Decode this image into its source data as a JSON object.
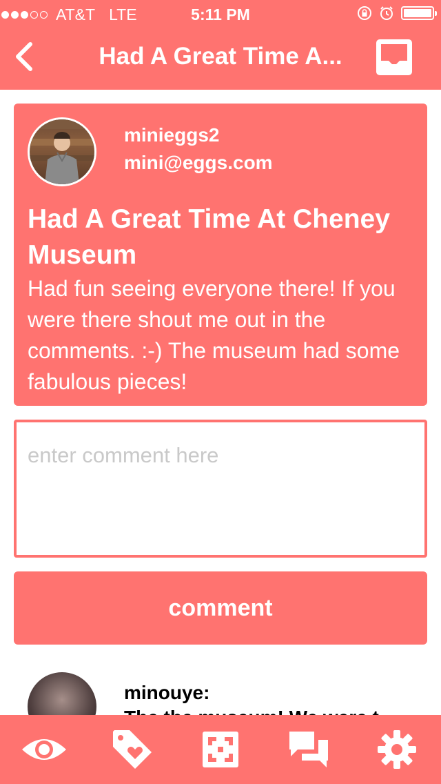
{
  "status_bar": {
    "carrier": "AT&T",
    "network": "LTE",
    "time": "5:11 PM",
    "signal_dots_filled": 3,
    "signal_dots_total": 5
  },
  "nav": {
    "title": "Had A Great Time A...",
    "back_icon": "chevron-left-icon",
    "inbox_icon": "inbox-icon"
  },
  "post": {
    "username": "minieggs2",
    "email": "mini@eggs.com",
    "title": "Had A Great Time At Cheney Museum",
    "body": "Had fun seeing everyone there! If you were there shout me out in the comments. :-) The museum had some fabulous pieces!"
  },
  "comment_input": {
    "placeholder": "enter comment here",
    "value": ""
  },
  "comment_button": {
    "label": "comment"
  },
  "comments": [
    {
      "user": "minouye:",
      "text": "The the museum! We were t"
    }
  ],
  "tabbar": {
    "items": [
      "eye-icon",
      "tag-heart-icon",
      "qr-scan-icon",
      "chat-icon",
      "gear-icon"
    ]
  },
  "colors": {
    "accent": "#FF7370",
    "text_on_accent": "#FFFFFF"
  }
}
